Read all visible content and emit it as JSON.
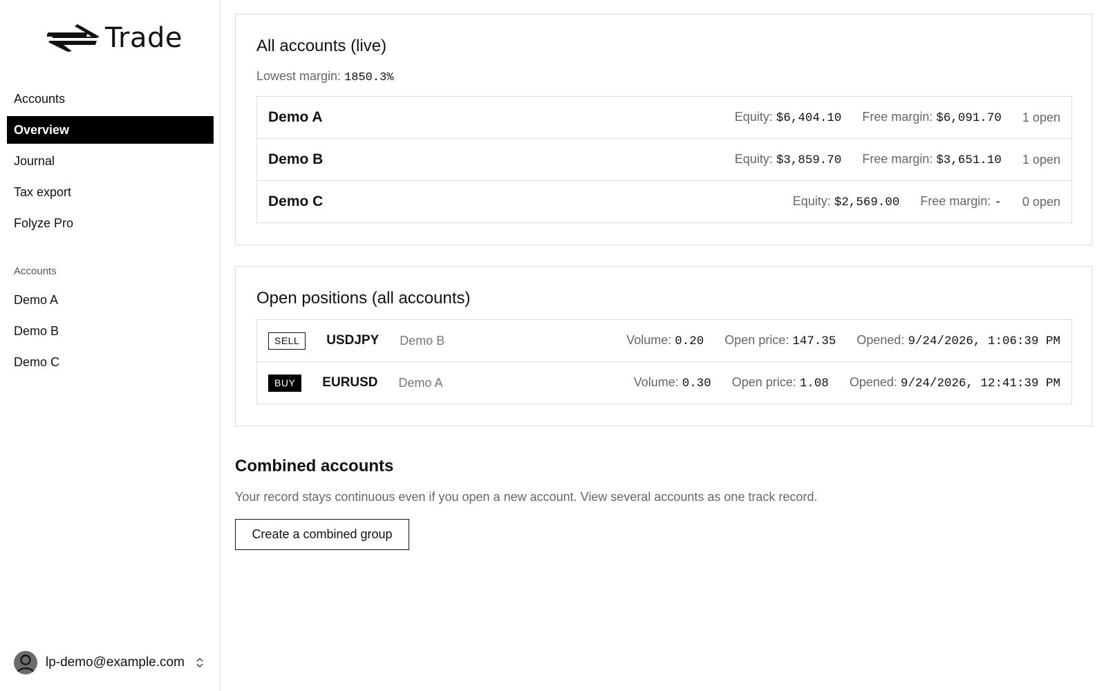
{
  "app": {
    "logo_text": "Trade"
  },
  "sidebar": {
    "nav": [
      {
        "label": "Accounts",
        "active": false
      },
      {
        "label": "Overview",
        "active": true
      },
      {
        "label": "Journal",
        "active": false
      },
      {
        "label": "Tax export",
        "active": false
      },
      {
        "label": "Folyze Pro",
        "active": false
      }
    ],
    "accounts_label": "Accounts",
    "accounts": [
      "Demo A",
      "Demo B",
      "Demo C"
    ],
    "user_email": "lp-demo@example.com"
  },
  "all_accounts": {
    "title": "All accounts (live)",
    "lowest_margin_label": "Lowest margin:",
    "lowest_margin_value": "1850.3%",
    "equity_label": "Equity:",
    "free_margin_label": "Free margin:",
    "rows": [
      {
        "name": "Demo A",
        "equity": "$6,404.10",
        "free_margin": "$6,091.70",
        "open": "1 open"
      },
      {
        "name": "Demo B",
        "equity": "$3,859.70",
        "free_margin": "$3,651.10",
        "open": "1 open"
      },
      {
        "name": "Demo C",
        "equity": "$2,569.00",
        "free_margin": "-",
        "open": "0 open"
      }
    ]
  },
  "open_positions": {
    "title": "Open positions (all accounts)",
    "volume_label": "Volume:",
    "open_price_label": "Open price:",
    "opened_label": "Opened:",
    "rows": [
      {
        "side": "SELL",
        "symbol": "USDJPY",
        "account": "Demo B",
        "volume": "0.20",
        "open_price": "147.35",
        "opened": "9/24/2026, 1:06:39 PM"
      },
      {
        "side": "BUY",
        "symbol": "EURUSD",
        "account": "Demo A",
        "volume": "0.30",
        "open_price": "1.08",
        "opened": "9/24/2026, 12:41:39 PM"
      }
    ]
  },
  "combined": {
    "title": "Combined accounts",
    "description": "Your record stays continuous even if you open a new account. View several accounts as one track record.",
    "button_label": "Create a combined group"
  }
}
